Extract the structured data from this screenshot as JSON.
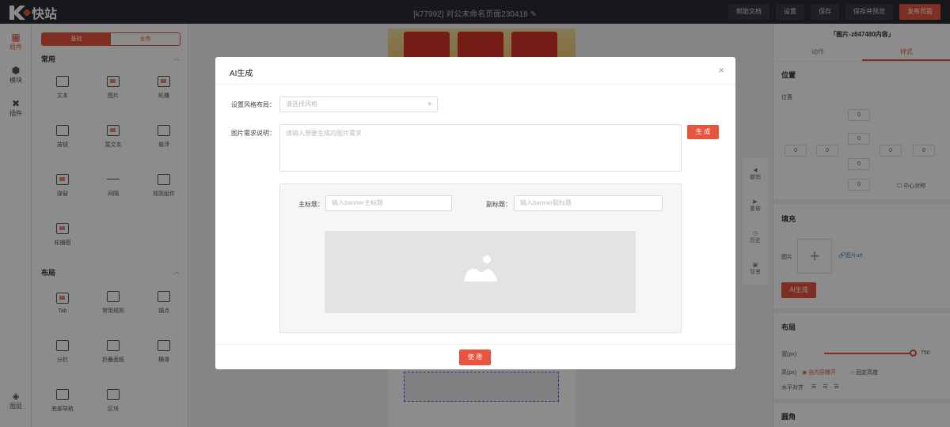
{
  "topbar": {
    "logo_text": "快站",
    "doc_title": "[k77992] 对公未命名页面230418",
    "actions": [
      "帮助文档",
      "设置",
      "保存",
      "保存并预览",
      "发布页面"
    ]
  },
  "rail": {
    "items": [
      "组件",
      "模块",
      "插件",
      "图层"
    ]
  },
  "left_panel": {
    "tabs": [
      "基础",
      "业务"
    ],
    "section_common": "常用",
    "common_items": [
      "文本",
      "图片",
      "轮播",
      "按钮",
      "富文本",
      "悬浮",
      "弹窗",
      "间隔",
      "规则组件",
      "轮播图"
    ],
    "section_layout": "布局",
    "layout_items": [
      "Tab",
      "常用规则",
      "锚点",
      "分栏",
      "折叠面板",
      "横滑",
      "底部导航",
      "区块"
    ]
  },
  "canvas": {
    "side_tools": [
      "撤销",
      "重做",
      "历史",
      "背景"
    ]
  },
  "right_panel": {
    "title": "「图片-z847480内容」",
    "tabs": [
      "动作",
      "样式"
    ],
    "sec_position": "位置",
    "position_label": "位置",
    "box_values": [
      "0",
      "0",
      "0",
      "0",
      "0",
      "0",
      "0",
      "0",
      "0"
    ],
    "center_symmetric": "中心对称",
    "sec_fill": "填充",
    "image_label": "图片",
    "image_url": "图片url",
    "ai_btn": "AI生成",
    "sec_layout": "布局",
    "width_label": "宽(px)",
    "width_value": "750",
    "height_label": "高(px)",
    "height_opt1": "自内容撑开",
    "height_opt2": "固定高度",
    "halign_label": "水平对齐",
    "sec_corner": "圆角"
  },
  "modal": {
    "title": "AI生成",
    "style_label": "设置风格布局：",
    "style_placeholder": "请选择风格",
    "desc_label": "图片需求说明：",
    "desc_placeholder": "请输入想要生成的图片需求",
    "generate_btn": "生 成",
    "main_title_label": "主标题：",
    "main_title_placeholder": "输入banner主标题",
    "sub_title_label": "副标题：",
    "sub_title_placeholder": "输入banner副标题",
    "use_btn": "使 用"
  },
  "colors": {
    "accent": "#e8553e",
    "topbar": "#2b2b33"
  }
}
